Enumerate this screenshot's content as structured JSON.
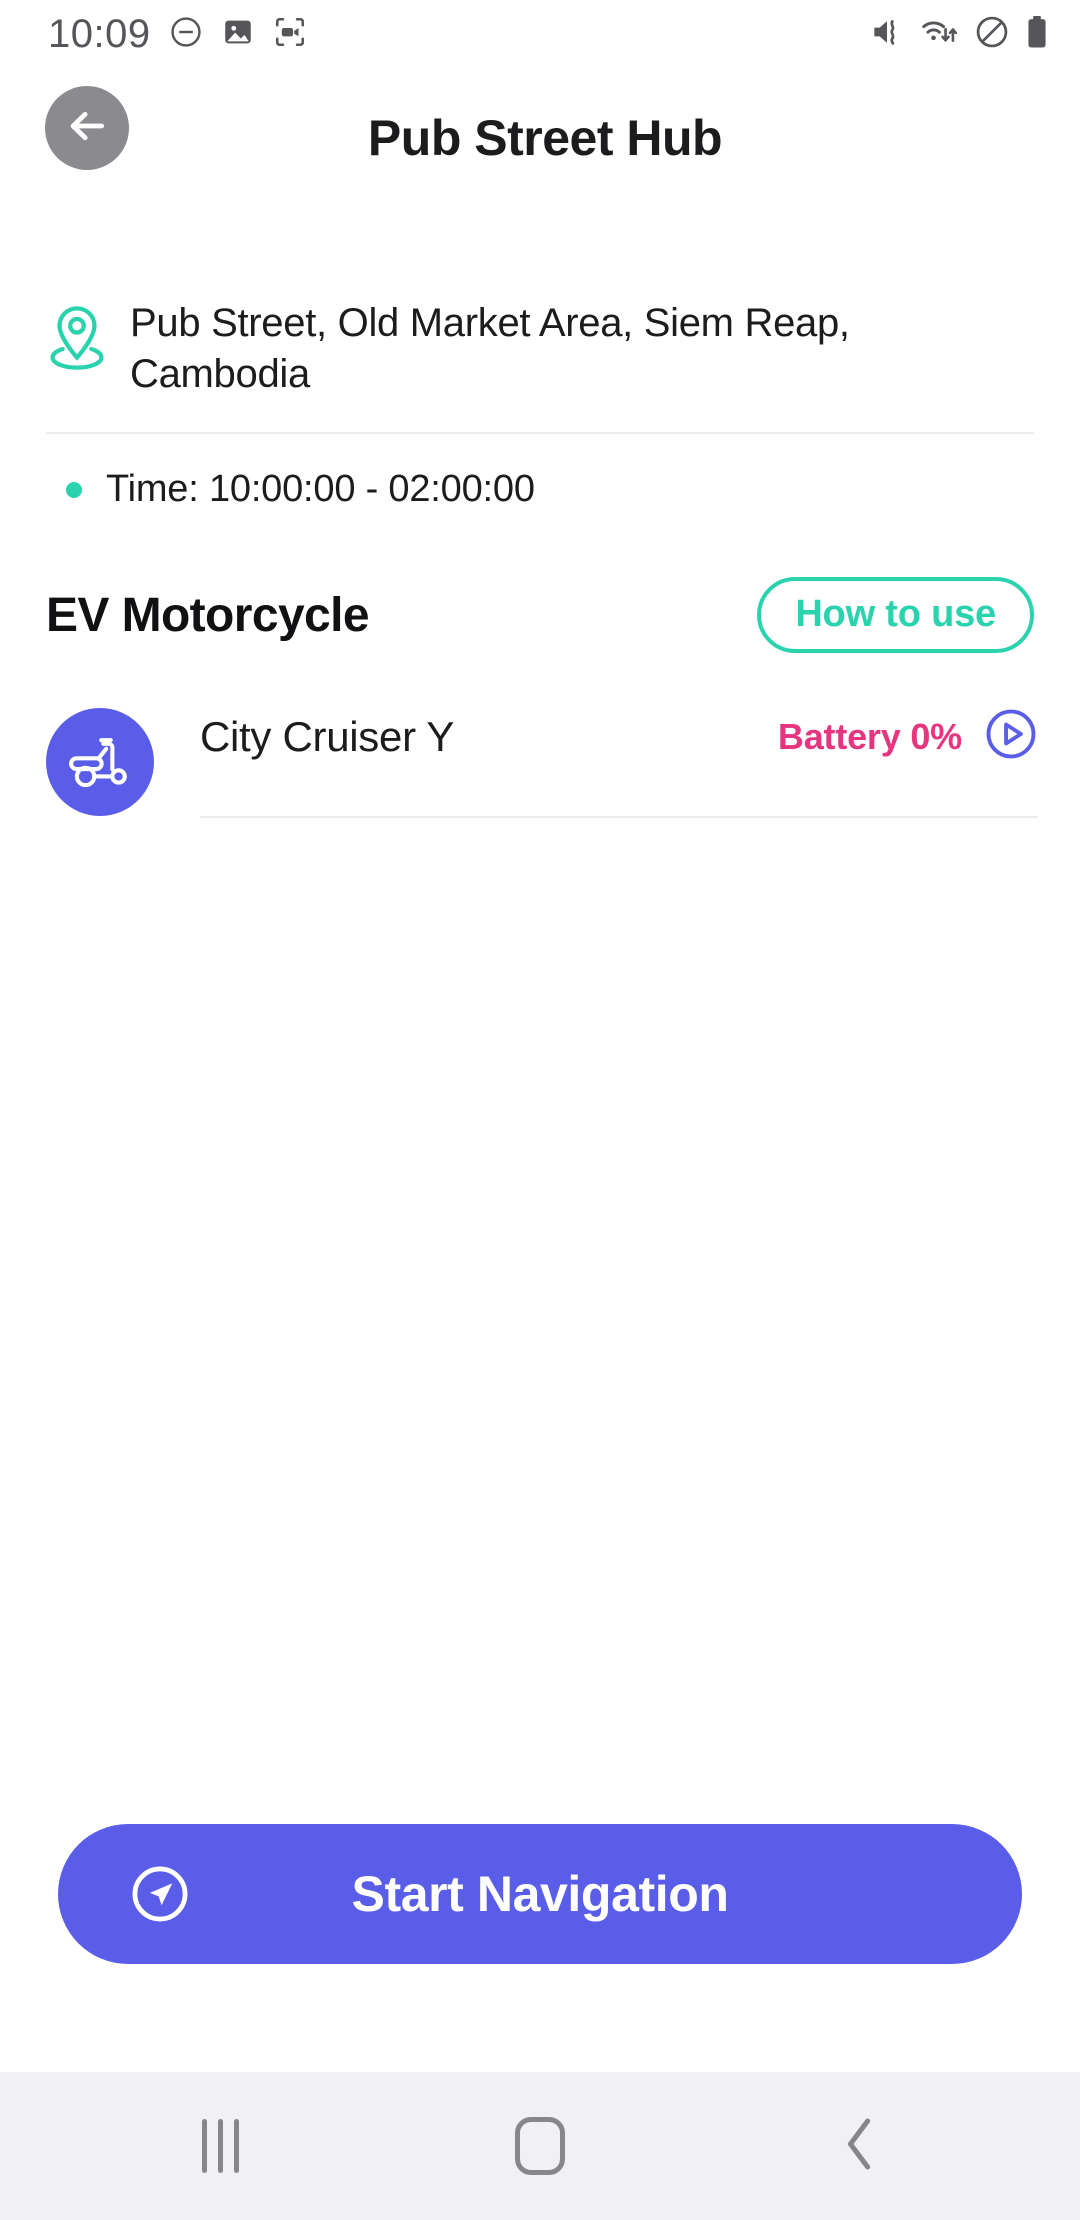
{
  "status_bar": {
    "time": "10:09",
    "left_icons": [
      "do-not-disturb-icon",
      "image-icon",
      "screen-recorder-icon"
    ],
    "right_icons": [
      "vibrate-icon",
      "wifi-data-icon",
      "blocked-icon",
      "battery-icon"
    ]
  },
  "app_bar": {
    "title": "Pub Street Hub",
    "back_icon": "arrow-left-icon"
  },
  "station": {
    "address": "Pub Street, Old Market Area, Siem Reap, Cambodia",
    "address_icon": "location-pin-icon",
    "time_label": "Time: 10:00:00 - 02:00:00"
  },
  "section": {
    "title": "EV Motorcycle",
    "how_to_use_label": "How to use"
  },
  "vehicles": [
    {
      "name": "City Cruiser Y",
      "icon": "scooter-icon",
      "battery_label": "Battery 0%",
      "action_icon": "play-circle-icon"
    }
  ],
  "cta": {
    "label": "Start Navigation",
    "icon": "navigation-arrow-icon"
  },
  "nav_bar": {
    "recents_label": "recents-icon",
    "home_label": "home-icon",
    "back_label": "back-chevron-icon"
  },
  "colors": {
    "accent_teal": "#2ad3ad",
    "accent_purple": "#5a5de8",
    "battery_pink": "#e8357f",
    "text_dark": "#1c1c1e",
    "divider": "#ececf0",
    "nav_bar_bg": "#f1f1f4"
  }
}
